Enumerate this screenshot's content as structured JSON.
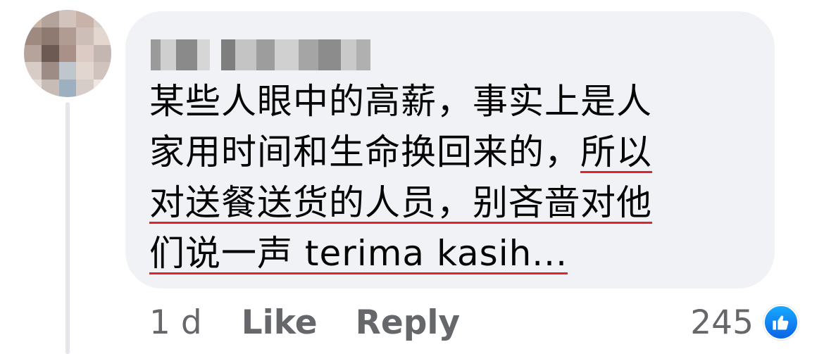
{
  "comment": {
    "lines": [
      {
        "parts": [
          {
            "text": "某些人眼中的高薪，事实上是人",
            "u": false
          }
        ]
      },
      {
        "parts": [
          {
            "text": "家用时间和生命换回来的，",
            "u": false
          },
          {
            "text": "所以",
            "u": true
          }
        ]
      },
      {
        "parts": [
          {
            "text": "对送餐送货的人员，别吝啬对他",
            "u": true
          }
        ]
      },
      {
        "parts": [
          {
            "text": "们说一声 terima kasih...",
            "u": true
          }
        ]
      }
    ]
  },
  "actions": {
    "time": "1 d",
    "like": "Like",
    "reply": "Reply"
  },
  "reactions": {
    "count": "245",
    "icon": "thumbs-up-icon",
    "color": "#1877f2"
  },
  "colors": {
    "bubble": "#f0f2f5",
    "underline": "#e0242f",
    "secondary_text": "#65676b"
  }
}
